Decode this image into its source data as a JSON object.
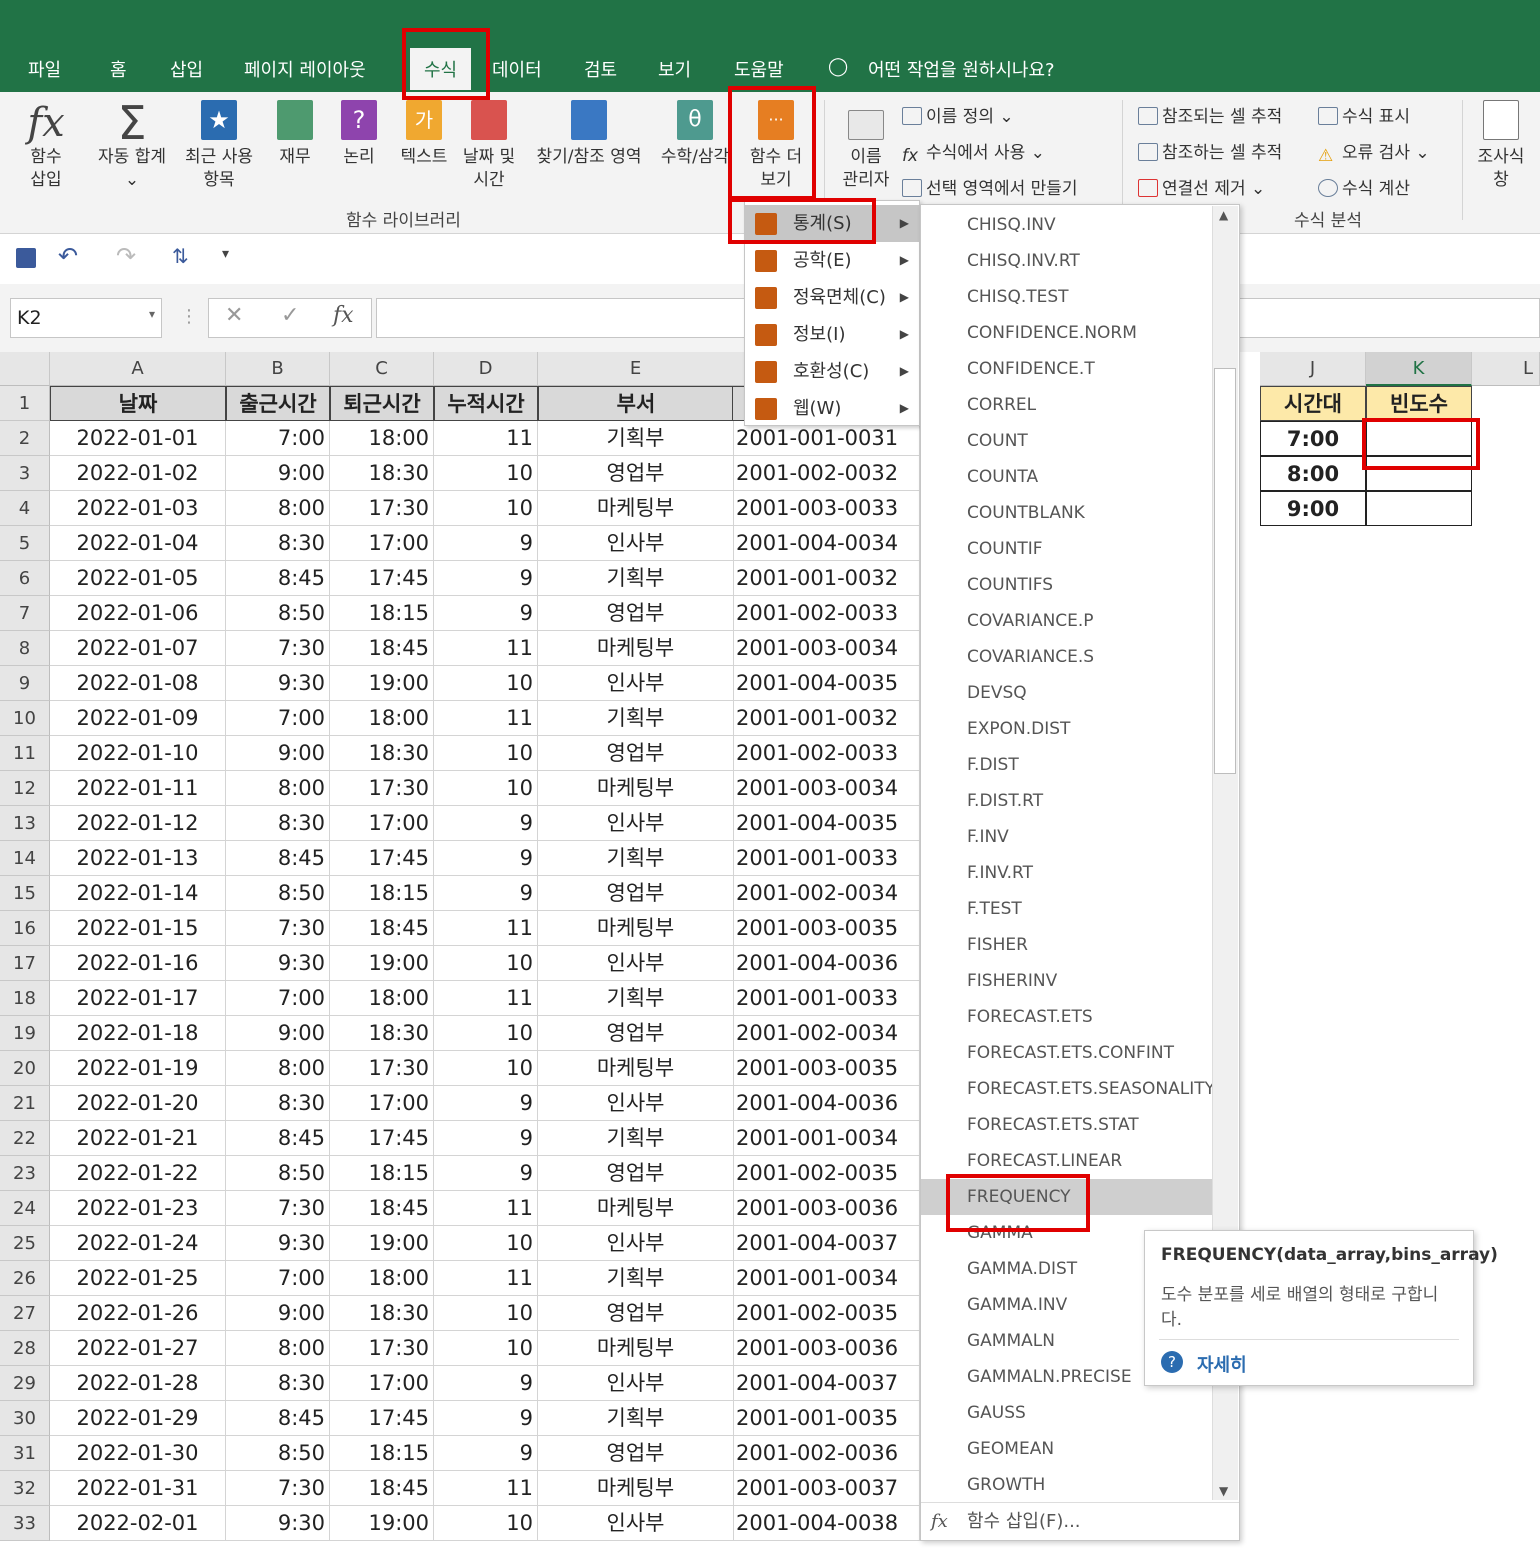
{
  "tabs": [
    "파일",
    "홈",
    "삽입",
    "페이지 레이아웃",
    "수식",
    "데이터",
    "검토",
    "보기",
    "도움말"
  ],
  "tell_me": "어떤 작업을 원하시나요?",
  "ribbon": {
    "insert_function": [
      "함수",
      "삽입"
    ],
    "autosum": [
      "자동 합계"
    ],
    "recent": [
      "최근 사용",
      "항목"
    ],
    "financial": [
      "재무"
    ],
    "logical": [
      "논리"
    ],
    "text": [
      "텍스트"
    ],
    "datetime": [
      "날짜 및",
      "시간"
    ],
    "lookup": [
      "찾기/참조 영역"
    ],
    "math": [
      "수학/삼각"
    ],
    "more": [
      "함수 더",
      "보기"
    ],
    "name_manager": [
      "이름",
      "관리자"
    ],
    "define_name": "이름 정의",
    "use_in_formula": "수식에서 사용",
    "create_from_selection": "선택 영역에서 만들기",
    "trace_precedents": "참조되는 셀 추적",
    "trace_dependents": "참조하는 셀 추적",
    "remove_arrows": "연결선 제거",
    "show_formulas": "수식 표시",
    "error_check": "오류 검사",
    "evaluate": "수식 계산",
    "watch": [
      "조사식",
      "창"
    ],
    "group_function_library": "함수 라이브러리",
    "group_formula_audit": "수식 분석"
  },
  "namebox": "K2",
  "columns": [
    "A",
    "B",
    "C",
    "D",
    "E",
    "J",
    "K",
    "L"
  ],
  "headers": [
    "날짜",
    "출근시간",
    "퇴근시간",
    "누적시간",
    "부서"
  ],
  "jk_headers": [
    "시간대",
    "빈도수"
  ],
  "jk_values": [
    "7:00",
    "8:00",
    "9:00"
  ],
  "rows": [
    [
      "2022-01-01",
      "7:00",
      "18:00",
      "11",
      "기획부",
      "2001-001-0031"
    ],
    [
      "2022-01-02",
      "9:00",
      "18:30",
      "10",
      "영업부",
      "2001-002-0032"
    ],
    [
      "2022-01-03",
      "8:00",
      "17:30",
      "10",
      "마케팅부",
      "2001-003-0033"
    ],
    [
      "2022-01-04",
      "8:30",
      "17:00",
      "9",
      "인사부",
      "2001-004-0034"
    ],
    [
      "2022-01-05",
      "8:45",
      "17:45",
      "9",
      "기획부",
      "2001-001-0032"
    ],
    [
      "2022-01-06",
      "8:50",
      "18:15",
      "9",
      "영업부",
      "2001-002-0033"
    ],
    [
      "2022-01-07",
      "7:30",
      "18:45",
      "11",
      "마케팅부",
      "2001-003-0034"
    ],
    [
      "2022-01-08",
      "9:30",
      "19:00",
      "10",
      "인사부",
      "2001-004-0035"
    ],
    [
      "2022-01-09",
      "7:00",
      "18:00",
      "11",
      "기획부",
      "2001-001-0032"
    ],
    [
      "2022-01-10",
      "9:00",
      "18:30",
      "10",
      "영업부",
      "2001-002-0033"
    ],
    [
      "2022-01-11",
      "8:00",
      "17:30",
      "10",
      "마케팅부",
      "2001-003-0034"
    ],
    [
      "2022-01-12",
      "8:30",
      "17:00",
      "9",
      "인사부",
      "2001-004-0035"
    ],
    [
      "2022-01-13",
      "8:45",
      "17:45",
      "9",
      "기획부",
      "2001-001-0033"
    ],
    [
      "2022-01-14",
      "8:50",
      "18:15",
      "9",
      "영업부",
      "2001-002-0034"
    ],
    [
      "2022-01-15",
      "7:30",
      "18:45",
      "11",
      "마케팅부",
      "2001-003-0035"
    ],
    [
      "2022-01-16",
      "9:30",
      "19:00",
      "10",
      "인사부",
      "2001-004-0036"
    ],
    [
      "2022-01-17",
      "7:00",
      "18:00",
      "11",
      "기획부",
      "2001-001-0033"
    ],
    [
      "2022-01-18",
      "9:00",
      "18:30",
      "10",
      "영업부",
      "2001-002-0034"
    ],
    [
      "2022-01-19",
      "8:00",
      "17:30",
      "10",
      "마케팅부",
      "2001-003-0035"
    ],
    [
      "2022-01-20",
      "8:30",
      "17:00",
      "9",
      "인사부",
      "2001-004-0036"
    ],
    [
      "2022-01-21",
      "8:45",
      "17:45",
      "9",
      "기획부",
      "2001-001-0034"
    ],
    [
      "2022-01-22",
      "8:50",
      "18:15",
      "9",
      "영업부",
      "2001-002-0035"
    ],
    [
      "2022-01-23",
      "7:30",
      "18:45",
      "11",
      "마케팅부",
      "2001-003-0036"
    ],
    [
      "2022-01-24",
      "9:30",
      "19:00",
      "10",
      "인사부",
      "2001-004-0037"
    ],
    [
      "2022-01-25",
      "7:00",
      "18:00",
      "11",
      "기획부",
      "2001-001-0034"
    ],
    [
      "2022-01-26",
      "9:00",
      "18:30",
      "10",
      "영업부",
      "2001-002-0035"
    ],
    [
      "2022-01-27",
      "8:00",
      "17:30",
      "10",
      "마케팅부",
      "2001-003-0036"
    ],
    [
      "2022-01-28",
      "8:30",
      "17:00",
      "9",
      "인사부",
      "2001-004-0037"
    ],
    [
      "2022-01-29",
      "8:45",
      "17:45",
      "9",
      "기획부",
      "2001-001-0035"
    ],
    [
      "2022-01-30",
      "8:50",
      "18:15",
      "9",
      "영업부",
      "2001-002-0036"
    ],
    [
      "2022-01-31",
      "7:30",
      "18:45",
      "11",
      "마케팅부",
      "2001-003-0037"
    ],
    [
      "2022-02-01",
      "9:30",
      "19:00",
      "10",
      "인사부",
      "2001-004-0038"
    ]
  ],
  "submenu": [
    {
      "label": "통계(S)",
      "icon": "statistics-icon"
    },
    {
      "label": "공학(E)",
      "icon": "engineering-icon"
    },
    {
      "label": "정육면체(C)",
      "icon": "cube-icon"
    },
    {
      "label": "정보(I)",
      "icon": "info-icon"
    },
    {
      "label": "호환성(C)",
      "icon": "compatibility-icon"
    },
    {
      "label": "웹(W)",
      "icon": "web-icon"
    }
  ],
  "functions": [
    "CHISQ.INV",
    "CHISQ.INV.RT",
    "CHISQ.TEST",
    "CONFIDENCE.NORM",
    "CONFIDENCE.T",
    "CORREL",
    "COUNT",
    "COUNTA",
    "COUNTBLANK",
    "COUNTIF",
    "COUNTIFS",
    "COVARIANCE.P",
    "COVARIANCE.S",
    "DEVSQ",
    "EXPON.DIST",
    "F.DIST",
    "F.DIST.RT",
    "F.INV",
    "F.INV.RT",
    "F.TEST",
    "FISHER",
    "FISHERINV",
    "FORECAST.ETS",
    "FORECAST.ETS.CONFINT",
    "FORECAST.ETS.SEASONALITY",
    "FORECAST.ETS.STAT",
    "FORECAST.LINEAR",
    "FREQUENCY",
    "GAMMA",
    "GAMMA.DIST",
    "GAMMA.INV",
    "GAMMALN",
    "GAMMALN.PRECISE",
    "GAUSS",
    "GEOMEAN",
    "GROWTH"
  ],
  "insert_function_item": "함수 삽입(F)...",
  "tooltip": {
    "title": "FREQUENCY(data_array,bins_array)",
    "desc": "도수 분포를 세로 배열의 형태로 구합니다.",
    "more": "자세히"
  },
  "colors": {
    "excel_green": "#217346",
    "highlight_red": "#e00000"
  }
}
